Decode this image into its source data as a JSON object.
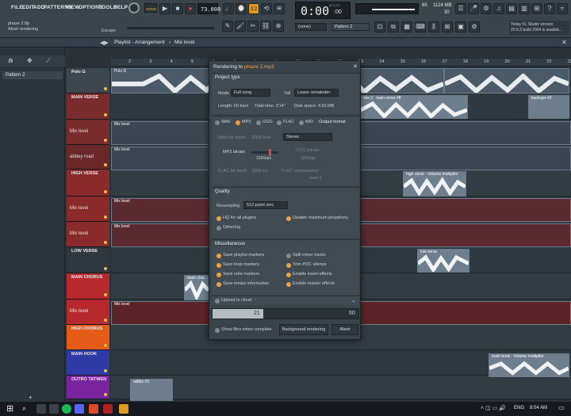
{
  "menu": [
    "FILE",
    "EDIT",
    "ADD",
    "PATTERNS",
    "VIEW",
    "OPTIONS",
    "TOOLS",
    "HELP"
  ],
  "transport": {
    "song_label": "SONG",
    "tempo": "73.000",
    "pattern": "3:2",
    "time": "0:00",
    "time_sub": ":00",
    "time_label": "M:S:CS",
    "cpu": "65",
    "mem": "1124 MB",
    "voices": "30"
  },
  "hint": {
    "file": "phaze 2.flp",
    "status": "Abort rendering",
    "shortcut": "Escape"
  },
  "toolbar": {
    "snap": "(none)",
    "pattern": "Pattern 2"
  },
  "news": {
    "line1": "Today  FL Studio version",
    "line2": "20.8.3 build 2304 is availab..."
  },
  "playlist": {
    "title": "Playlist - Arrangement",
    "lane_sel": "Mix level",
    "ruler": [
      "2",
      "3",
      "4",
      "5",
      "6",
      "7",
      "8",
      "9",
      "10",
      "11",
      "12",
      "13",
      "14",
      "15",
      "16",
      "17",
      "18",
      "19",
      "20",
      "21",
      "22",
      "23"
    ]
  },
  "browser": {
    "pattern": "Pattern 2"
  },
  "tracks": [
    {
      "name": "Polo G",
      "color": "#3c4750"
    },
    {
      "name": "MAIN VERSE",
      "color": "#7a2b2b"
    },
    {
      "name": "",
      "sub": "Mix level",
      "color": "#7a2b2b"
    },
    {
      "name": "",
      "sub": "abbey road",
      "color": "#6a2828"
    },
    {
      "name": "HIGH VERSE",
      "color": "#8a2a2a"
    },
    {
      "name": "",
      "sub": "Mix level",
      "color": "#8a2a2a"
    },
    {
      "name": "",
      "sub": "Mix level",
      "color": "#8a2a2a"
    },
    {
      "name": "LOW VERSE",
      "color": "#2f383e"
    },
    {
      "name": "MAIN CHORUS",
      "color": "#b8292d"
    },
    {
      "name": "",
      "sub": "Mix level",
      "color": "#b8292d"
    },
    {
      "name": "HIGH CHORUS",
      "color": "#e45a16"
    },
    {
      "name": "MAIN HOOK",
      "color": "#2e3aa6"
    },
    {
      "name": "OUTRO TATWEN",
      "color": "#7a24a0"
    }
  ],
  "clips": {
    "polo": "Polo G",
    "mix": "Mix level",
    "main_verse": "main verse #8",
    "mix2": "mix 2",
    "backups": "backups #2",
    "high_verse": "high verse - Volume multiplier",
    "low_verse": "low verse",
    "main_chorus": "main chor...",
    "main_hook": "main hook - Volume multiplier",
    "adlibs": "adlibs #3"
  },
  "dialog": {
    "title_prefix": "Rendering to",
    "filename": "phaze 2.mp3",
    "project_type": "Project type",
    "mode_label": "Mode",
    "mode_value": "Full song",
    "tail_label": "Tail",
    "tail_value": "Leave remainder",
    "length": "Length: 60 bars",
    "total_time": "Total time: 3'14\"",
    "disk_space": "Disk space: 4.50 MB",
    "formats": [
      "WAV",
      "MP3",
      "OGG",
      "FLAC",
      "MID"
    ],
    "output_format": "Output format",
    "wav_depth": "WAV bit depth",
    "wav_depth_val": "32Bit float",
    "stereo": "Stereo",
    "mp3_bitrate": "MP3 bitrate",
    "mp3_bitrate_val": "192kbps",
    "ogg_bitrate": "OGG bitrate",
    "ogg_bitrate_val": "192kbps",
    "flac_depth": "FLAC bit depth",
    "flac_depth_val": "16Bit int",
    "flac_comp": "FLAC compression",
    "flac_comp_val": "level 5",
    "quality": "Quality",
    "resampling": "Resampling",
    "resampling_val": "512-point sinc",
    "hq_all": "HQ for all plugins",
    "disable_max_poly": "Disable maximum polyphony",
    "dithering": "Dithering",
    "misc": "Miscellaneous",
    "misc_opts_left": [
      "Save playlist markers",
      "Save loop markers",
      "Save note markers",
      "Save tempo information"
    ],
    "misc_opts_right": [
      "Split mixer tracks",
      "Trim PDC silence",
      "Enable insert effects",
      "Enable master effects"
    ],
    "upload": "Upload to cloud",
    "progress_current": "21",
    "progress_total": "60",
    "progress": 0.35,
    "show_when_complete": "Show files when complete",
    "background": "Background rendering",
    "abort": "Abort"
  },
  "taskbar": {
    "lang": "ENG",
    "time": "8:04 AM"
  }
}
